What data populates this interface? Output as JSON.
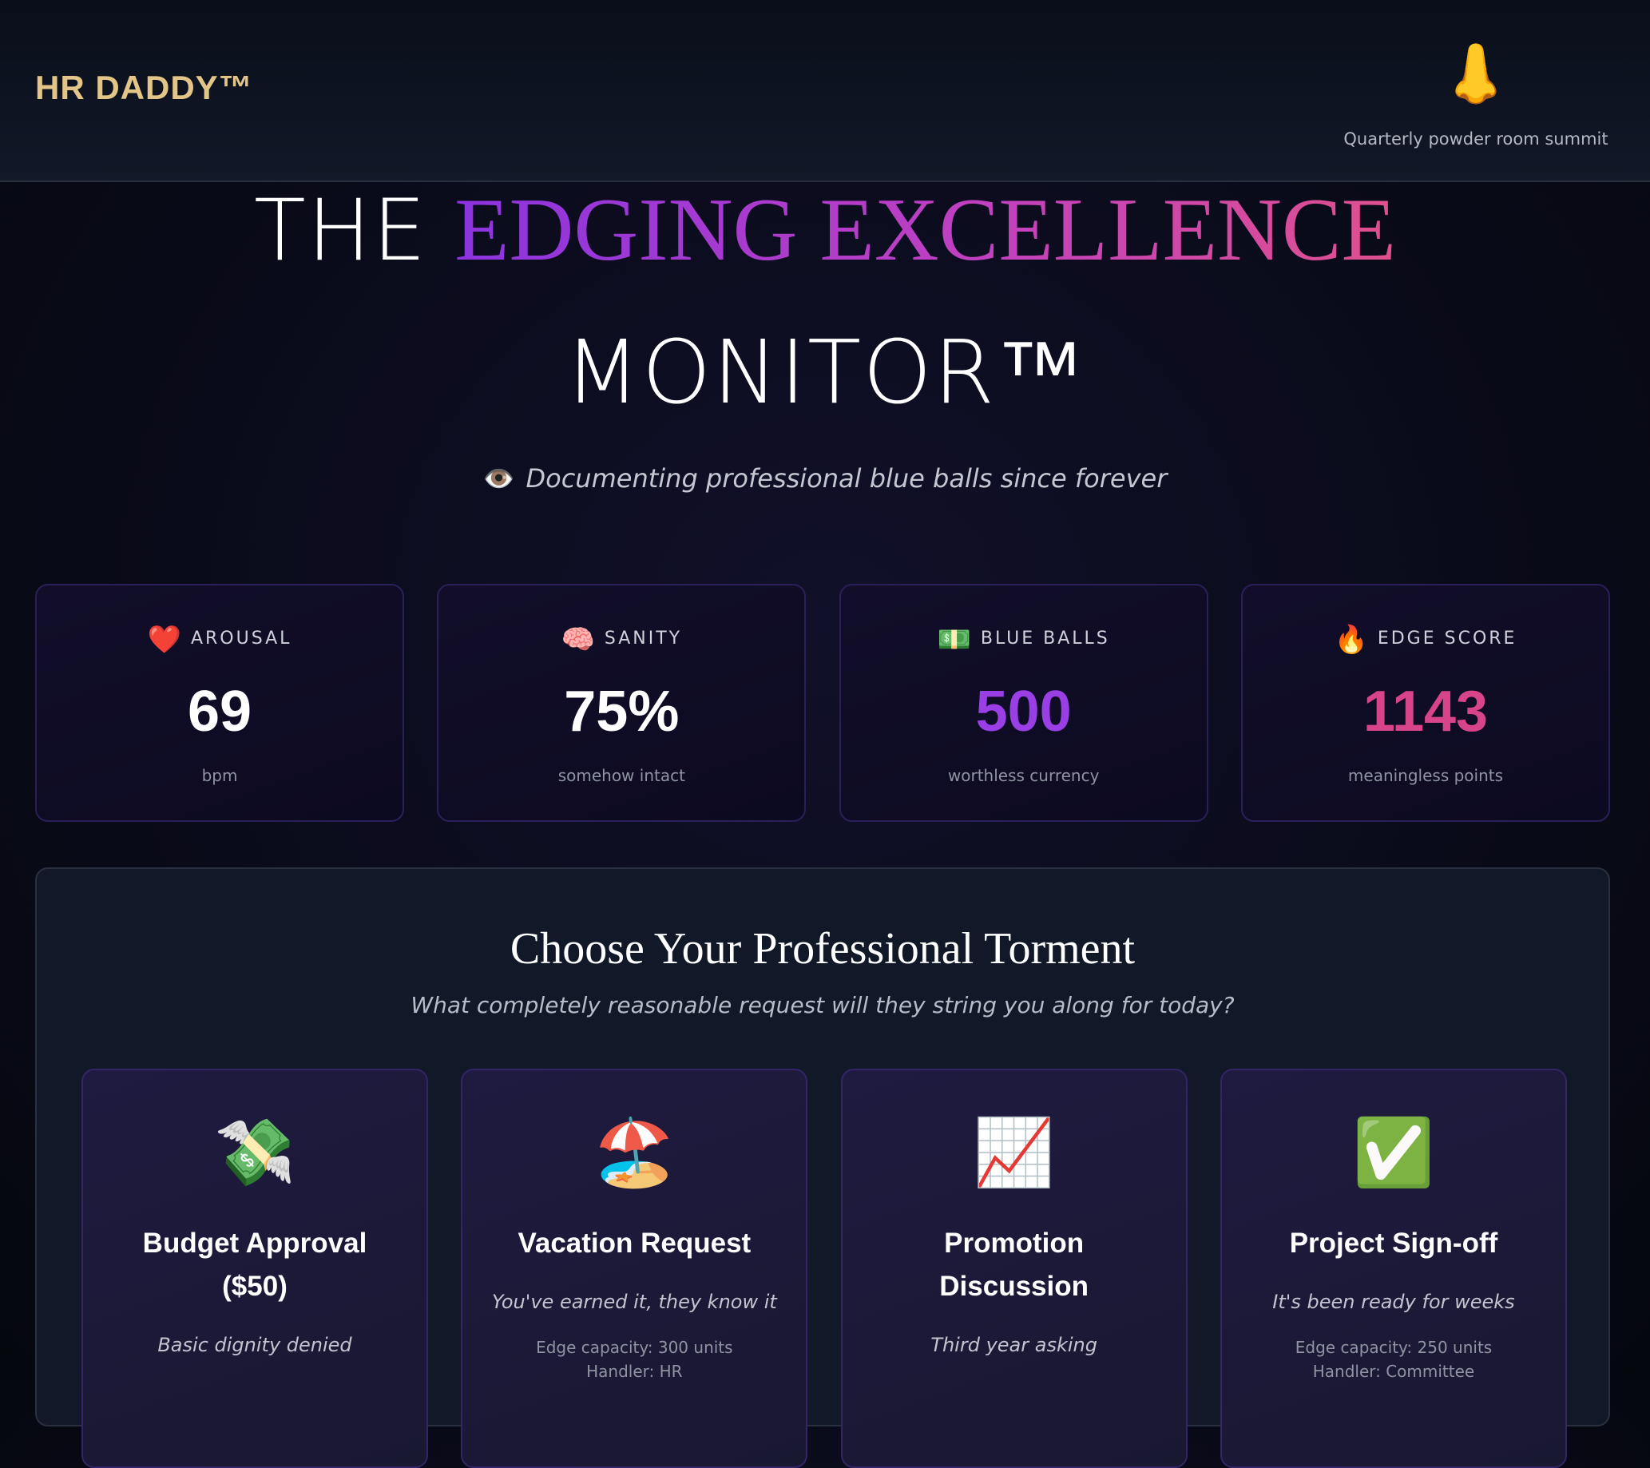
{
  "header": {
    "brand": "HR DADDY™",
    "summit_icon": "nose-icon",
    "summit_emoji": "👃",
    "summit_label": "Quarterly powder room summit"
  },
  "hero": {
    "title_the": "THE",
    "title_highlight": "EDGING EXCELLENCE",
    "title_line2": "MONITOR™",
    "subtitle_icon": "👁️",
    "subtitle": "Documenting professional blue balls since forever"
  },
  "colors": {
    "brand_gold": "#e2c587",
    "value_white": "#ffffff",
    "value_purple": "#9a3ee6",
    "value_pink": "#d7448a",
    "gradient_start": "#8b34e0",
    "gradient_end": "#e0508e"
  },
  "stats": [
    {
      "icon": "❤️",
      "icon_name": "heart-icon",
      "label": "AROUSAL",
      "value": "69",
      "unit": "bpm",
      "color": "#ffffff"
    },
    {
      "icon": "🧠",
      "icon_name": "brain-icon",
      "label": "SANITY",
      "value": "75%",
      "unit": "somehow intact",
      "color": "#ffffff"
    },
    {
      "icon": "💵",
      "icon_name": "dollar-bill-icon",
      "label": "BLUE BALLS",
      "value": "500",
      "unit": "worthless currency",
      "color": "#9a3ee6"
    },
    {
      "icon": "🔥",
      "icon_name": "fire-icon",
      "label": "EDGE SCORE",
      "value": "1143",
      "unit": "meaningless points",
      "color": "#d7448a"
    }
  ],
  "torment": {
    "title": "Choose Your Professional Torment",
    "subtitle": "What completely reasonable request will they string you along for today?",
    "cards": [
      {
        "icon": "💸",
        "icon_name": "money-with-wings-icon",
        "title": "Budget Approval ($50)",
        "desc": "Basic dignity denied",
        "capacity": "",
        "handler": ""
      },
      {
        "icon": "🏖️",
        "icon_name": "beach-umbrella-icon",
        "title": "Vacation Request",
        "desc": "You've earned it, they know it",
        "capacity": "Edge capacity: 300 units",
        "handler": "Handler: HR"
      },
      {
        "icon": "📈",
        "icon_name": "chart-increasing-icon",
        "title": "Promotion Discussion",
        "desc": "Third year asking",
        "capacity": "",
        "handler": ""
      },
      {
        "icon": "✅",
        "icon_name": "check-mark-icon",
        "title": "Project Sign-off",
        "desc": "It's been ready for weeks",
        "capacity": "Edge capacity: 250 units",
        "handler": "Handler: Committee"
      }
    ]
  }
}
